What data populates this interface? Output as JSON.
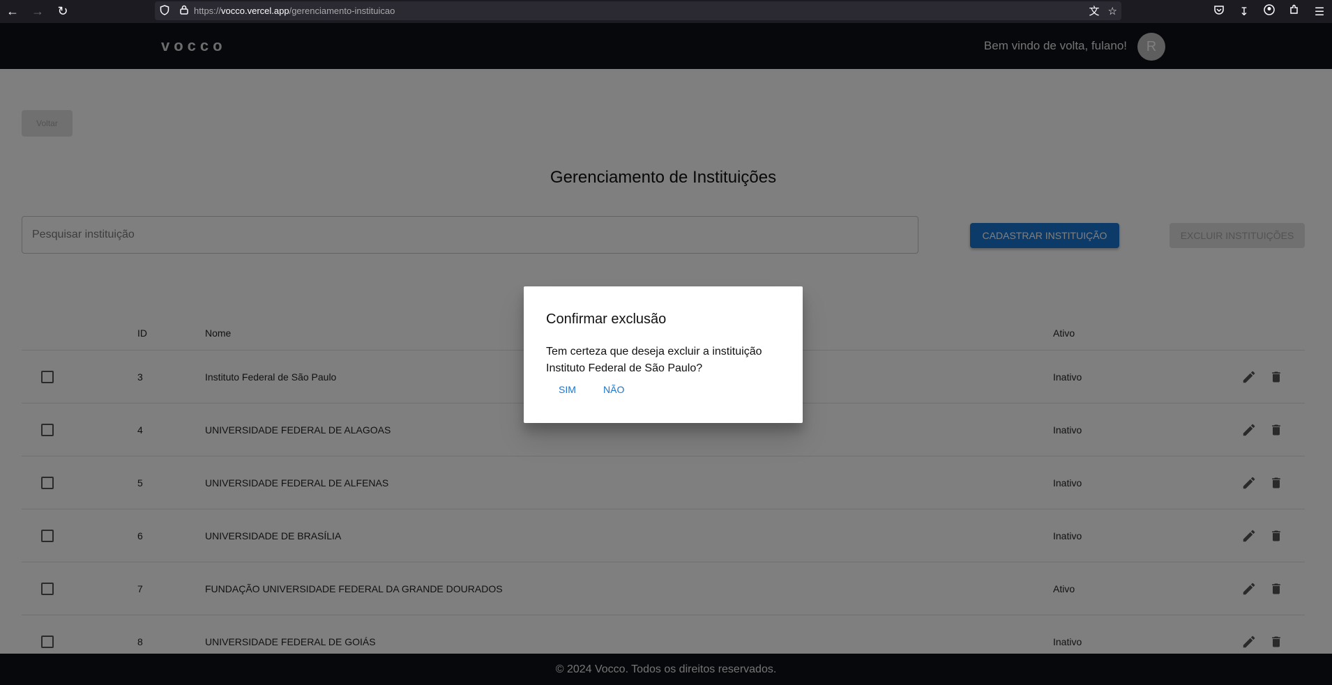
{
  "browser": {
    "url_prefix": "https://",
    "url_domain": "vocco.vercel.app",
    "url_path": "/gerenciamento-instituicao"
  },
  "header": {
    "logo": "vocco",
    "welcome": "Bem vindo de volta, fulano!",
    "avatar_letter": "R"
  },
  "page": {
    "back_label": "Voltar",
    "title": "Gerenciamento de Instituições",
    "search_placeholder": "Pesquisar instituição",
    "register_button": "CADASTRAR INSTITUIÇÃO",
    "delete_button": "EXCLUIR INSTITUIÇÕES"
  },
  "table": {
    "headers": {
      "id": "ID",
      "name": "Nome",
      "active": "Ativo"
    },
    "rows": [
      {
        "id": "3",
        "name": "Instituto Federal de São Paulo",
        "status": "Inativo"
      },
      {
        "id": "4",
        "name": "UNIVERSIDADE FEDERAL DE ALAGOAS",
        "status": "Inativo"
      },
      {
        "id": "5",
        "name": "UNIVERSIDADE FEDERAL DE ALFENAS",
        "status": "Inativo"
      },
      {
        "id": "6",
        "name": "UNIVERSIDADE DE BRASÍLIA",
        "status": "Inativo"
      },
      {
        "id": "7",
        "name": "FUNDAÇÃO UNIVERSIDADE FEDERAL DA GRANDE DOURADOS",
        "status": "Ativo"
      },
      {
        "id": "8",
        "name": "UNIVERSIDADE FEDERAL DE GOIÁS",
        "status": "Inativo"
      }
    ]
  },
  "footer": {
    "text": "© 2024 Vocco. Todos os direitos reservados."
  },
  "dialog": {
    "title": "Confirmar exclusão",
    "message": "Tem certeza que deseja excluir a instituição Instituto Federal de São Paulo?",
    "yes": "SIM",
    "no": "NÃO"
  },
  "colors": {
    "primary": "#1976d2",
    "header_bg": "#0d1117",
    "overlay": "rgba(0,0,0,0.5)"
  },
  "icons": [
    "back-arrow-icon",
    "forward-arrow-icon",
    "reload-icon",
    "shield-icon",
    "lock-icon",
    "translate-icon",
    "bookmark-star-icon",
    "pocket-icon",
    "download-icon",
    "account-icon",
    "extensions-icon",
    "menu-icon",
    "checkbox-icon",
    "edit-pencil-icon",
    "delete-trash-icon"
  ]
}
